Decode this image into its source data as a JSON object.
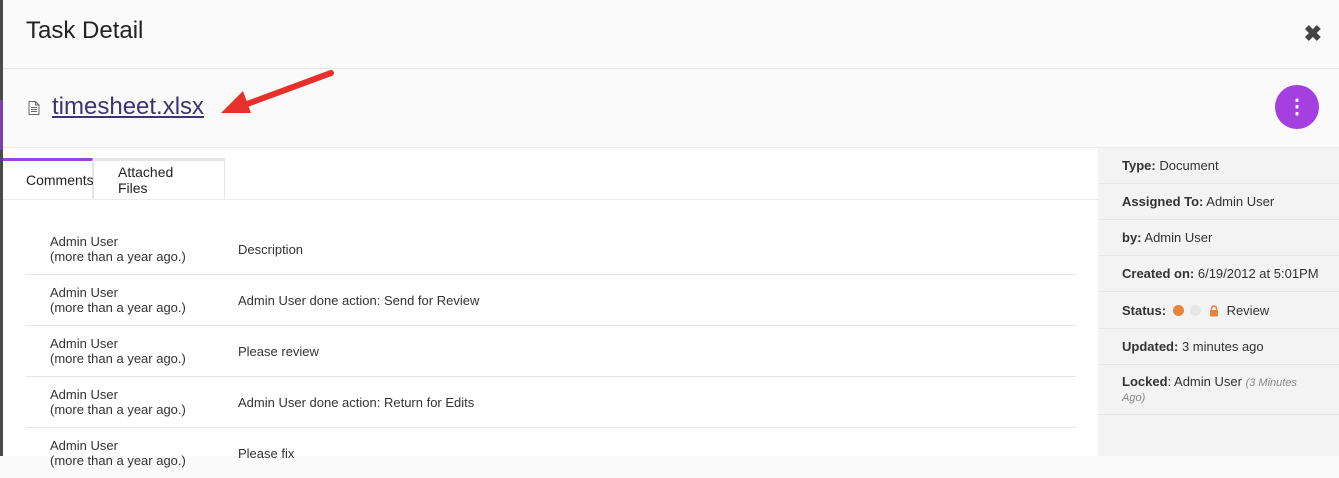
{
  "dialog": {
    "title": "Task Detail",
    "close_label": "✖"
  },
  "file": {
    "name": "timesheet.xlsx",
    "icon": "document-icon"
  },
  "menu_button": {
    "label": "⋮",
    "color": "#a43fe0"
  },
  "tabs": [
    {
      "label": "Comments",
      "active": true
    },
    {
      "label": "Attached Files",
      "active": false
    }
  ],
  "comments": [
    {
      "author": "Admin User",
      "when": "(more than a year ago.)",
      "text": "Description"
    },
    {
      "author": "Admin User",
      "when": "(more than a year ago.)",
      "text": "Admin User done action: Send for Review"
    },
    {
      "author": "Admin User",
      "when": "(more than a year ago.)",
      "text": "Please review"
    },
    {
      "author": "Admin User",
      "when": "(more than a year ago.)",
      "text": "Admin User done action: Return for Edits"
    },
    {
      "author": "Admin User",
      "when": "(more than a year ago.)",
      "text": "Please fix"
    }
  ],
  "details": {
    "type_label": "Type:",
    "type_value": "Document",
    "assigned_label": "Assigned To:",
    "assigned_value": "Admin User",
    "by_label": "by:",
    "by_value": "Admin User",
    "created_label": "Created on:",
    "created_value": "6/19/2012 at 5:01PM",
    "status_label": "Status:",
    "status_value": "Review",
    "status_colors": [
      "#e8833a",
      "#e6e6e6"
    ],
    "updated_label": "Updated:",
    "updated_value": "3 minutes ago",
    "locked_label": "Locked",
    "locked_value": ": Admin User",
    "locked_note_1": "(3 Minutes",
    "locked_note_2": "Ago)"
  },
  "colors": {
    "accent": "#9b44d6",
    "link": "#3d3475",
    "arrow": "#e8302a",
    "lock": "#e8833a"
  }
}
